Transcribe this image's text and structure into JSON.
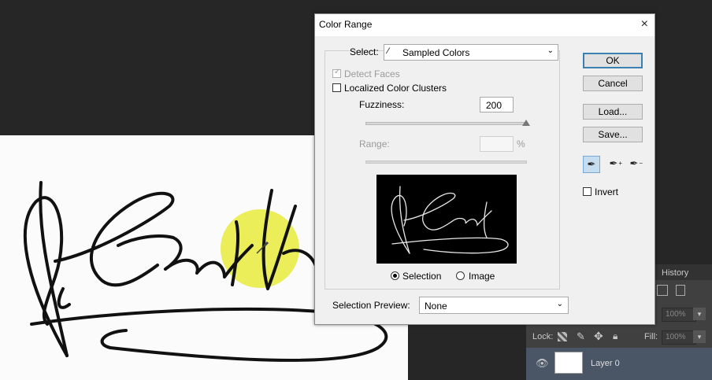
{
  "dialog": {
    "title": "Color Range",
    "close_glyph": "×",
    "select_label": "Select:",
    "select_value": "Sampled Colors",
    "detect_faces": "Detect Faces",
    "localized_clusters": "Localized Color Clusters",
    "fuzziness_label": "Fuzziness:",
    "fuzziness_value": "200",
    "fuzziness_level": 1.0,
    "range_label": "Range:",
    "range_unit": "%",
    "radio_selection": "Selection",
    "radio_image": "Image",
    "preview_label": "Selection Preview:",
    "preview_value": "None",
    "buttons": {
      "ok": "OK",
      "cancel": "Cancel",
      "load": "Load...",
      "save": "Save..."
    },
    "invert_label": "Invert",
    "preview_text": "P.Smith"
  },
  "layers_panel": {
    "tab_history": "History",
    "lock_label": "Lock:",
    "fill_label": "Fill:",
    "opacity_value": "100%",
    "fill_value": "100%",
    "layer_name": "Layer 0"
  },
  "colors": {
    "accent": "#3c7fb1",
    "highlight": "#e7ea3a"
  }
}
